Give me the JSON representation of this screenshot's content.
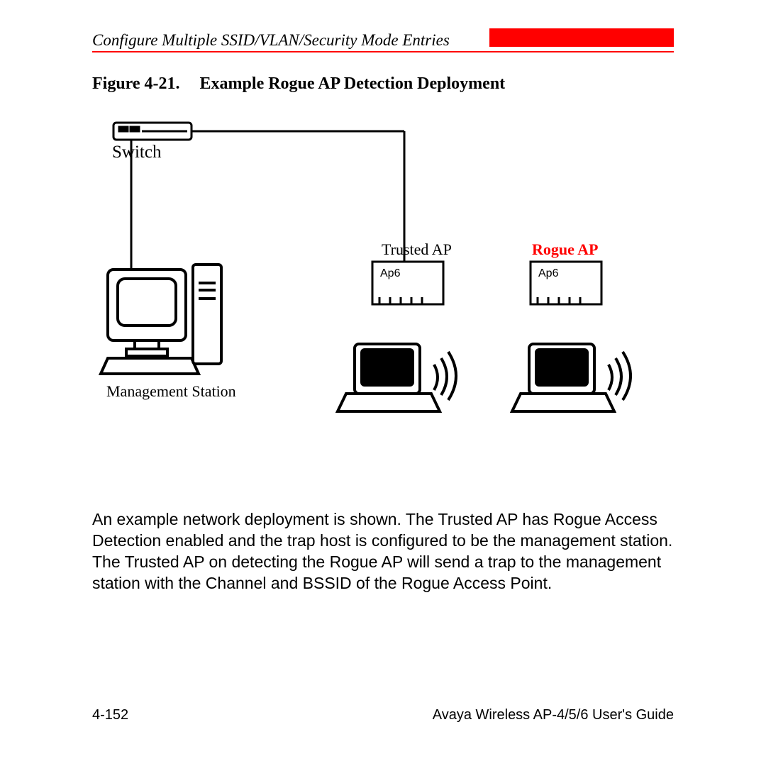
{
  "header": {
    "title": "Configure Multiple SSID/VLAN/Security Mode Entries"
  },
  "figure": {
    "number": "Figure 4-21.",
    "title": "Example Rogue AP Detection Deployment",
    "labels": {
      "switch": "Switch",
      "trusted_ap": "Trusted AP",
      "rogue_ap": "Rogue AP",
      "management_station": "Management Station",
      "ap_device_text": "Ap6"
    }
  },
  "body": {
    "paragraph": "An example network deployment is shown. The Trusted AP has Rogue Access Detection enabled and the trap host is configured to be the management station. The Trusted AP on detecting the Rogue AP will send a trap to the management station with the Channel and BSSID of the Rogue Access Point."
  },
  "footer": {
    "page": "4-152",
    "guide": "Avaya Wireless AP-4/5/6 User's Guide"
  }
}
